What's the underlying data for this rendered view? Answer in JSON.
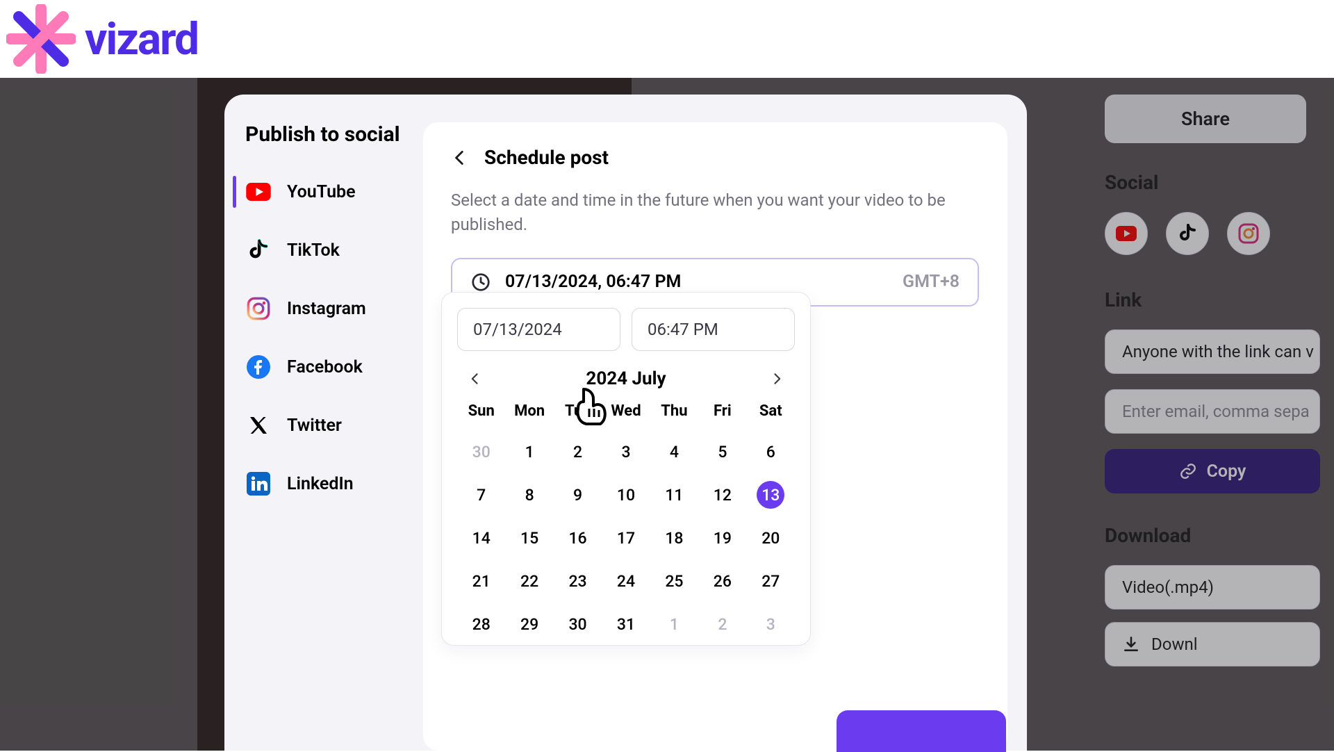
{
  "brand": {
    "name": "vizard"
  },
  "right": {
    "share": "Share",
    "social_heading": "Social",
    "link_heading": "Link",
    "link_visibility": "Anyone with the link can v",
    "email_placeholder": "Enter email, comma sepa",
    "copy_label": "Copy",
    "download_heading": "Download",
    "download_mp4": "Video(.mp4)",
    "download_action": "Downl"
  },
  "modal": {
    "title": "Publish to social",
    "platforms": [
      {
        "label": "YouTube"
      },
      {
        "label": "TikTok"
      },
      {
        "label": "Instagram"
      },
      {
        "label": "Facebook"
      },
      {
        "label": "Twitter"
      },
      {
        "label": "LinkedIn"
      }
    ],
    "panel": {
      "title": "Schedule post",
      "desc": "Select a date and time in the future when you want your video to be published.",
      "datetime": "07/13/2024, 06:47 PM",
      "timezone": "GMT+8"
    },
    "calendar": {
      "date_input": "07/13/2024",
      "time_input": "06:47 PM",
      "month_label": "2024 July",
      "weekdays": [
        "Sun",
        "Mon",
        "Tue",
        "Wed",
        "Thu",
        "Fri",
        "Sat"
      ],
      "days": [
        {
          "n": "30",
          "muted": true
        },
        {
          "n": "1"
        },
        {
          "n": "2"
        },
        {
          "n": "3"
        },
        {
          "n": "4"
        },
        {
          "n": "5"
        },
        {
          "n": "6"
        },
        {
          "n": "7"
        },
        {
          "n": "8"
        },
        {
          "n": "9"
        },
        {
          "n": "10"
        },
        {
          "n": "11"
        },
        {
          "n": "12"
        },
        {
          "n": "13",
          "sel": true
        },
        {
          "n": "14"
        },
        {
          "n": "15"
        },
        {
          "n": "16"
        },
        {
          "n": "17"
        },
        {
          "n": "18"
        },
        {
          "n": "19"
        },
        {
          "n": "20"
        },
        {
          "n": "21"
        },
        {
          "n": "22"
        },
        {
          "n": "23"
        },
        {
          "n": "24"
        },
        {
          "n": "25"
        },
        {
          "n": "26"
        },
        {
          "n": "27"
        },
        {
          "n": "28"
        },
        {
          "n": "29"
        },
        {
          "n": "30"
        },
        {
          "n": "31"
        },
        {
          "n": "1",
          "muted": true
        },
        {
          "n": "2",
          "muted": true
        },
        {
          "n": "3",
          "muted": true
        }
      ]
    }
  }
}
